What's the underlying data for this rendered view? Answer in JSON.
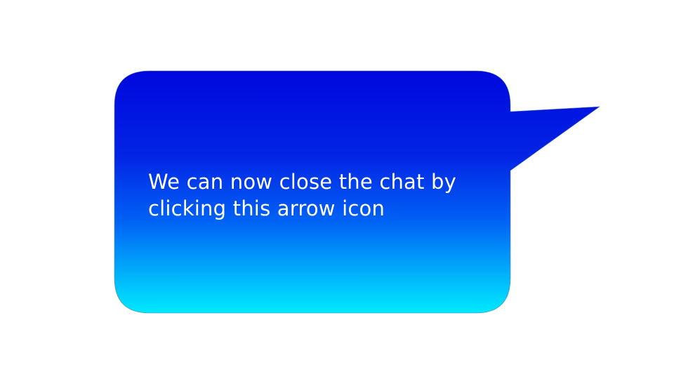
{
  "callout": {
    "line1": "We can now close the chat by",
    "line2": "clicking this arrow icon"
  },
  "colors": {
    "gradient_top": "#0008dd",
    "gradient_mid": "#0062f5",
    "gradient_bottom": "#00eaff",
    "text": "#ffffff",
    "background": "#ffffff"
  }
}
